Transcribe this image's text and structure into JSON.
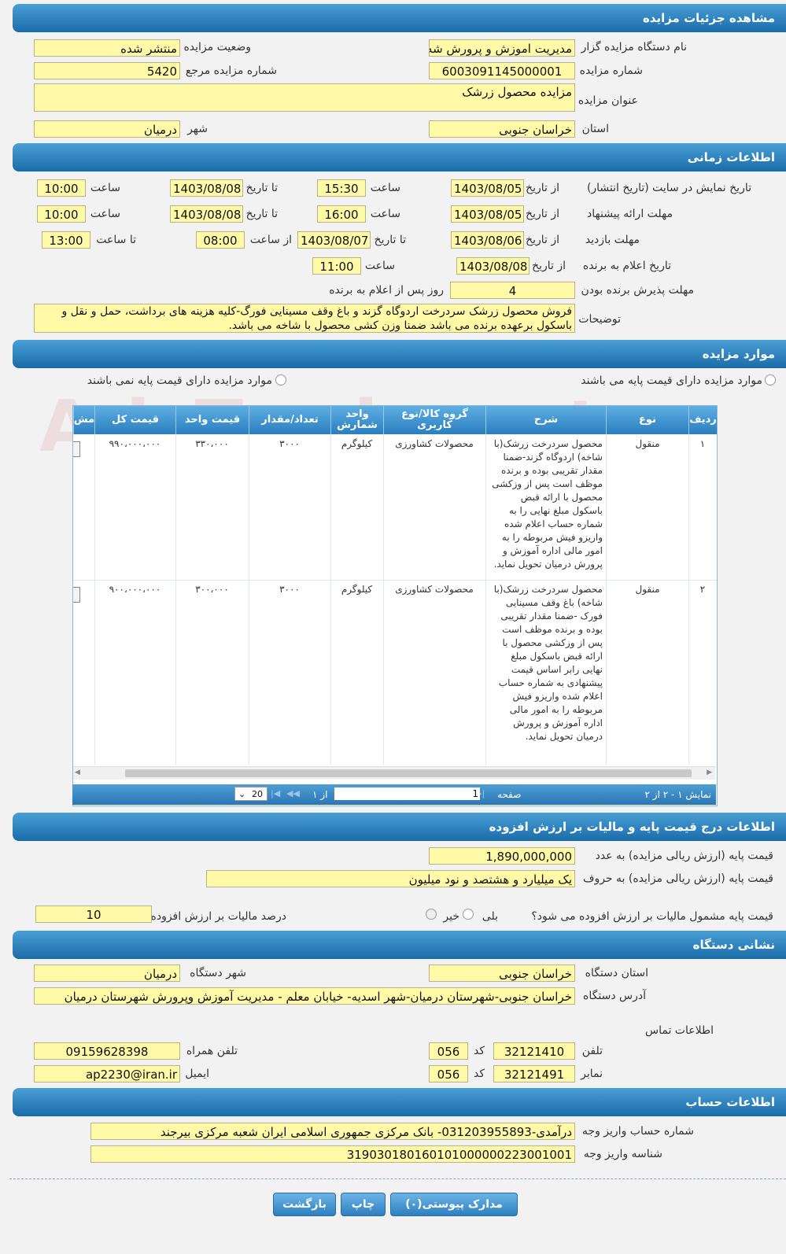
{
  "sections": {
    "details": "مشاهده جزئیات مزایده",
    "time": "اطلاعات زمانی",
    "items": "موارد مزایده",
    "price": "اطلاعات درج قیمت پایه و مالیات بر ارزش افزوده",
    "address": "نشانی دستگاه",
    "account": "اطلاعات حساب"
  },
  "details": {
    "org_label": "نام دستگاه مزایده گزار",
    "org_value": "مدیریت اموزش و پرورش شه",
    "status_label": "وضعیت مزایده",
    "status_value": "منتشر شده",
    "number_label": "شماره مزایده",
    "number_value": "6003091145000001",
    "ref_label": "شماره مزایده مرجع",
    "ref_value": "5420",
    "title_label": "عنوان مزایده",
    "title_value": "مزایده محصول زرشک",
    "province_label": "استان",
    "province_value": "خراسان جنوبی",
    "city_label": "شهر",
    "city_value": "درمیان"
  },
  "time": {
    "publish_label": "تاریخ نمایش در سایت (تاریخ انتشار)",
    "from_date": "از تاریخ",
    "to_date": "تا تاریخ",
    "hour": "ساعت",
    "from_hour": "از ساعت",
    "to_hour": "تا ساعت",
    "publish_from": "1403/08/05",
    "publish_from_time": "15:30",
    "publish_to": "1403/08/08",
    "publish_to_time": "10:00",
    "offer_label": "مهلت ارائه پیشنهاد",
    "offer_from": "1403/08/05",
    "offer_from_time": "16:00",
    "offer_to": "1403/08/08",
    "offer_to_time": "10:00",
    "visit_label": "مهلت بازدید",
    "visit_from": "1403/08/06",
    "visit_to": "1403/08/07",
    "visit_from_time": "08:00",
    "visit_to_time": "13:00",
    "winner_label": "تاریخ اعلام به برنده",
    "winner_from": "1403/08/08",
    "winner_time": "11:00",
    "accept_label": "مهلت پذیرش برنده بودن",
    "accept_value": "4",
    "accept_suffix": "روز پس از اعلام به برنده",
    "desc_label": "توضیحات",
    "desc_value": "فروش محصول زرشک سردرخت اردوگاه گزند و باغ وقف مسینایی فورگ-کلیه هزینه های برداشت، حمل و نقل و باسکول برعهده برنده می باشد ضمنا وزن کشی محصول با شاخه می باشد."
  },
  "items": {
    "radio_with": "موارد مزایده دارای قیمت پایه می باشند",
    "radio_without": "موارد مزایده دارای قیمت پایه نمی باشند",
    "headers": [
      "ردیف",
      "نوع",
      "شرح",
      "گروه کالا/نوع کاربری",
      "واحد شمارش",
      "تعداد/مقدار",
      "قیمت واحد",
      "قیمت کل",
      "مش"
    ],
    "rows": [
      {
        "idx": "۱",
        "type": "منقول",
        "desc": "محصول سردرخت زرشک(با شاخه) اردوگاه گزند-ضمنا مقدار تقریبی بوده و برنده موظف است پس از وزکشی محصول با ارائه قبض باسکول مبلغ نهایی را به شماره حساب اعلام شده واریزو فیش مربوطه را به امور مالی اداره آموزش و پرورش درمیان تحویل نماید.",
        "group": "محصولات کشاورزی",
        "unit": "کیلوگرم",
        "qty": "۳۰۰۰",
        "unit_price": "۳۳۰،۰۰۰",
        "total": "۹۹۰،۰۰۰،۰۰۰"
      },
      {
        "idx": "۲",
        "type": "منقول",
        "desc": "محصول سردرخت زرشک(با شاخه) باغ وقف مسینایی فورک -ضمنا مقدار تقریبی بوده و برنده موظف است پس از وزکشی محصول با ارائه قبض باسکول مبلغ نهایی رابر اساس قیمت پیشنهادی به شماره حساب اعلام شده واریزو فیش مربوطه را به امور مالی اداره آموزش و پرورش درمیان تحویل نماید.",
        "group": "محصولات کشاورزی",
        "unit": "کیلوگرم",
        "qty": "۳۰۰۰",
        "unit_price": "۳۰۰،۰۰۰",
        "total": "۹۰۰،۰۰۰،۰۰۰"
      }
    ],
    "pager": {
      "showing": "نمایش ۱ - ۲ از ۲",
      "page_label": "صفحه",
      "page_value": "1",
      "of": "از ۱",
      "page_size": "20"
    }
  },
  "price": {
    "num_label": "قیمت پایه (ارزش ریالی مزایده) به عدد",
    "num_value": "1,890,000,000",
    "text_label": "قیمت پایه (ارزش ریالی مزایده) به حروف",
    "text_value": "یک میلیارد و هشتصد و نود میلیون",
    "vat_q": "قیمت پایه مشمول مالیات بر ارزش افزوده می شود؟",
    "yes": "بلی",
    "no": "خیر",
    "vat_pct_label": "درصد مالیات بر ارزش افزوده",
    "vat_pct_value": "10"
  },
  "address": {
    "province_label": "استان دستگاه",
    "province_value": "خراسان جنوبی",
    "city_label": "شهر دستگاه",
    "city_value": "درمیان",
    "addr_label": "آدرس دستگاه",
    "addr_value": "خراسان جنوبی-شهرستان درمیان-شهر اسدیه- خیابان معلم - مدیریت آموزش وپرورش شهرستان درمیان",
    "contact_label": "اطلاعات تماس",
    "phone_label": "تلفن",
    "phone_value": "32121410",
    "code_label": "کد",
    "phone_code": "056",
    "mobile_label": "تلفن همراه",
    "mobile_value": "09159628398",
    "fax_label": "نمابر",
    "fax_value": "32121491",
    "fax_code": "056",
    "email_label": "ایمیل",
    "email_value": "ap2230@iran.ir"
  },
  "account": {
    "acc_label": "شماره حساب واریز وجه",
    "acc_value": "درآمدی-031203955893- بانک مرکزی جمهوری اسلامی ایران شعبه مرکزی بیرجند",
    "id_label": "شناسه واریز وجه",
    "id_value": "319030180160101000000223001001"
  },
  "buttons": {
    "attachments": "مدارک پیوستی(۰)",
    "print": "چاپ",
    "back": "بازگشت"
  },
  "watermark": "AriaTender.net"
}
